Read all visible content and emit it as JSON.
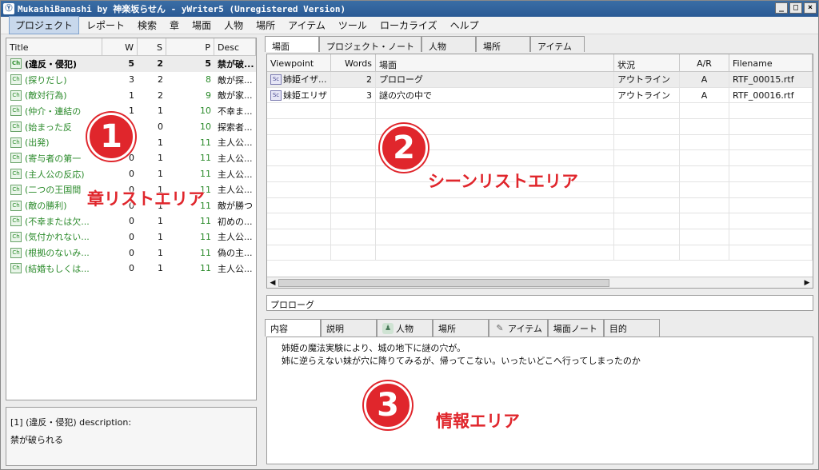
{
  "window": {
    "title": "MukashiBanashi by 神楽坂らせん - yWriter5 (Unregistered Version)",
    "buttons": [
      "_",
      "□",
      "×"
    ]
  },
  "menu": [
    "プロジェクト",
    "レポート",
    "検索",
    "章",
    "場面",
    "人物",
    "場所",
    "アイテム",
    "ツール",
    "ローカライズ",
    "ヘルプ"
  ],
  "chapters": {
    "headers": {
      "title": "Title",
      "w": "W",
      "s": "S",
      "p": "P",
      "desc": "Desc"
    },
    "rows": [
      {
        "icon": "Ch",
        "title": "(違反・侵犯)",
        "w": "5",
        "s": "2",
        "p": "5",
        "desc": "禁が破..."
      },
      {
        "icon": "Ch",
        "title": "(探りだし)",
        "w": "3",
        "s": "2",
        "p": "8",
        "desc": "敵が探..."
      },
      {
        "icon": "Ch",
        "title": "(敵対行為)",
        "w": "1",
        "s": "2",
        "p": "9",
        "desc": "敵が家..."
      },
      {
        "icon": "Ch",
        "title": "(仲介・連結の",
        "w": "1",
        "s": "1",
        "p": "10",
        "desc": "不幸ま..."
      },
      {
        "icon": "Ch",
        "title": "(始まった反",
        "w": "0",
        "s": "0",
        "p": "10",
        "desc": "探索者..."
      },
      {
        "icon": "Ch",
        "title": "(出発)",
        "w": "0",
        "s": "1",
        "p": "11",
        "desc": "主人公..."
      },
      {
        "icon": "Ch",
        "title": "(寄与者の第一",
        "w": "0",
        "s": "1",
        "p": "11",
        "desc": "主人公..."
      },
      {
        "icon": "Ch",
        "title": "(主人公の反応)",
        "w": "0",
        "s": "1",
        "p": "11",
        "desc": "主人公..."
      },
      {
        "icon": "Ch",
        "title": "(二つの王国間",
        "w": "0",
        "s": "1",
        "p": "11",
        "desc": "主人公..."
      },
      {
        "icon": "Ch",
        "title": "(敵の勝利)",
        "w": "0",
        "s": "1",
        "p": "11",
        "desc": "敵が勝つ"
      },
      {
        "icon": "Ch",
        "title": "(不幸または欠...",
        "w": "0",
        "s": "1",
        "p": "11",
        "desc": "初めの..."
      },
      {
        "icon": "Ch",
        "title": "(気付かれない...",
        "w": "0",
        "s": "1",
        "p": "11",
        "desc": "主人公..."
      },
      {
        "icon": "Ch",
        "title": "(根拠のないみ...",
        "w": "0",
        "s": "1",
        "p": "11",
        "desc": "偽の主..."
      },
      {
        "icon": "Ch",
        "title": "(結婚もしくは...",
        "w": "0",
        "s": "1",
        "p": "11",
        "desc": "主人公..."
      }
    ],
    "description_title": "[1] (違反・侵犯) description:",
    "description_text": "禁が破られる"
  },
  "top_tabs": [
    "場面",
    "プロジェクト・ノート",
    "人物",
    "場所",
    "アイテム"
  ],
  "scenes": {
    "headers": {
      "viewpoint": "Viewpoint",
      "words": "Words",
      "scene": "場面",
      "status": "状況",
      "ar": "A/R",
      "filename": "Filename"
    },
    "rows": [
      {
        "icon": "Sc",
        "viewpoint": "姉姫イザ...",
        "words": "2",
        "scene": "プロローグ",
        "status": "アウトライン",
        "ar": "A",
        "filename": "RTF_00015.rtf"
      },
      {
        "icon": "Sc",
        "viewpoint": "妹姫エリザ",
        "words": "3",
        "scene": "謎の穴の中で",
        "status": "アウトライン",
        "ar": "A",
        "filename": "RTF_00016.rtf"
      }
    ],
    "scroll_left": "◀",
    "scroll_right": "▶"
  },
  "scene_title": "プロローグ",
  "bottom_tabs": [
    {
      "label": "内容",
      "icon": ""
    },
    {
      "label": "説明",
      "icon": ""
    },
    {
      "label": "人物",
      "icon": "person-icon"
    },
    {
      "label": "場所",
      "icon": ""
    },
    {
      "label": "アイテム",
      "icon": "pencil-icon"
    },
    {
      "label": "場面ノート",
      "icon": ""
    },
    {
      "label": "目的",
      "icon": ""
    }
  ],
  "content": [
    "姉姫の魔法実験により、城の地下に謎の穴が。",
    "姉に逆らえない妹が穴に降りてみるが、帰ってこない。いったいどこへ行ってしまったのか"
  ],
  "annotations": {
    "n1": "1",
    "n2": "2",
    "n3": "3",
    "label1": "章リストエリア",
    "label2": "シーンリストエリア",
    "label3": "情報エリア",
    "color": "#e0262c"
  }
}
